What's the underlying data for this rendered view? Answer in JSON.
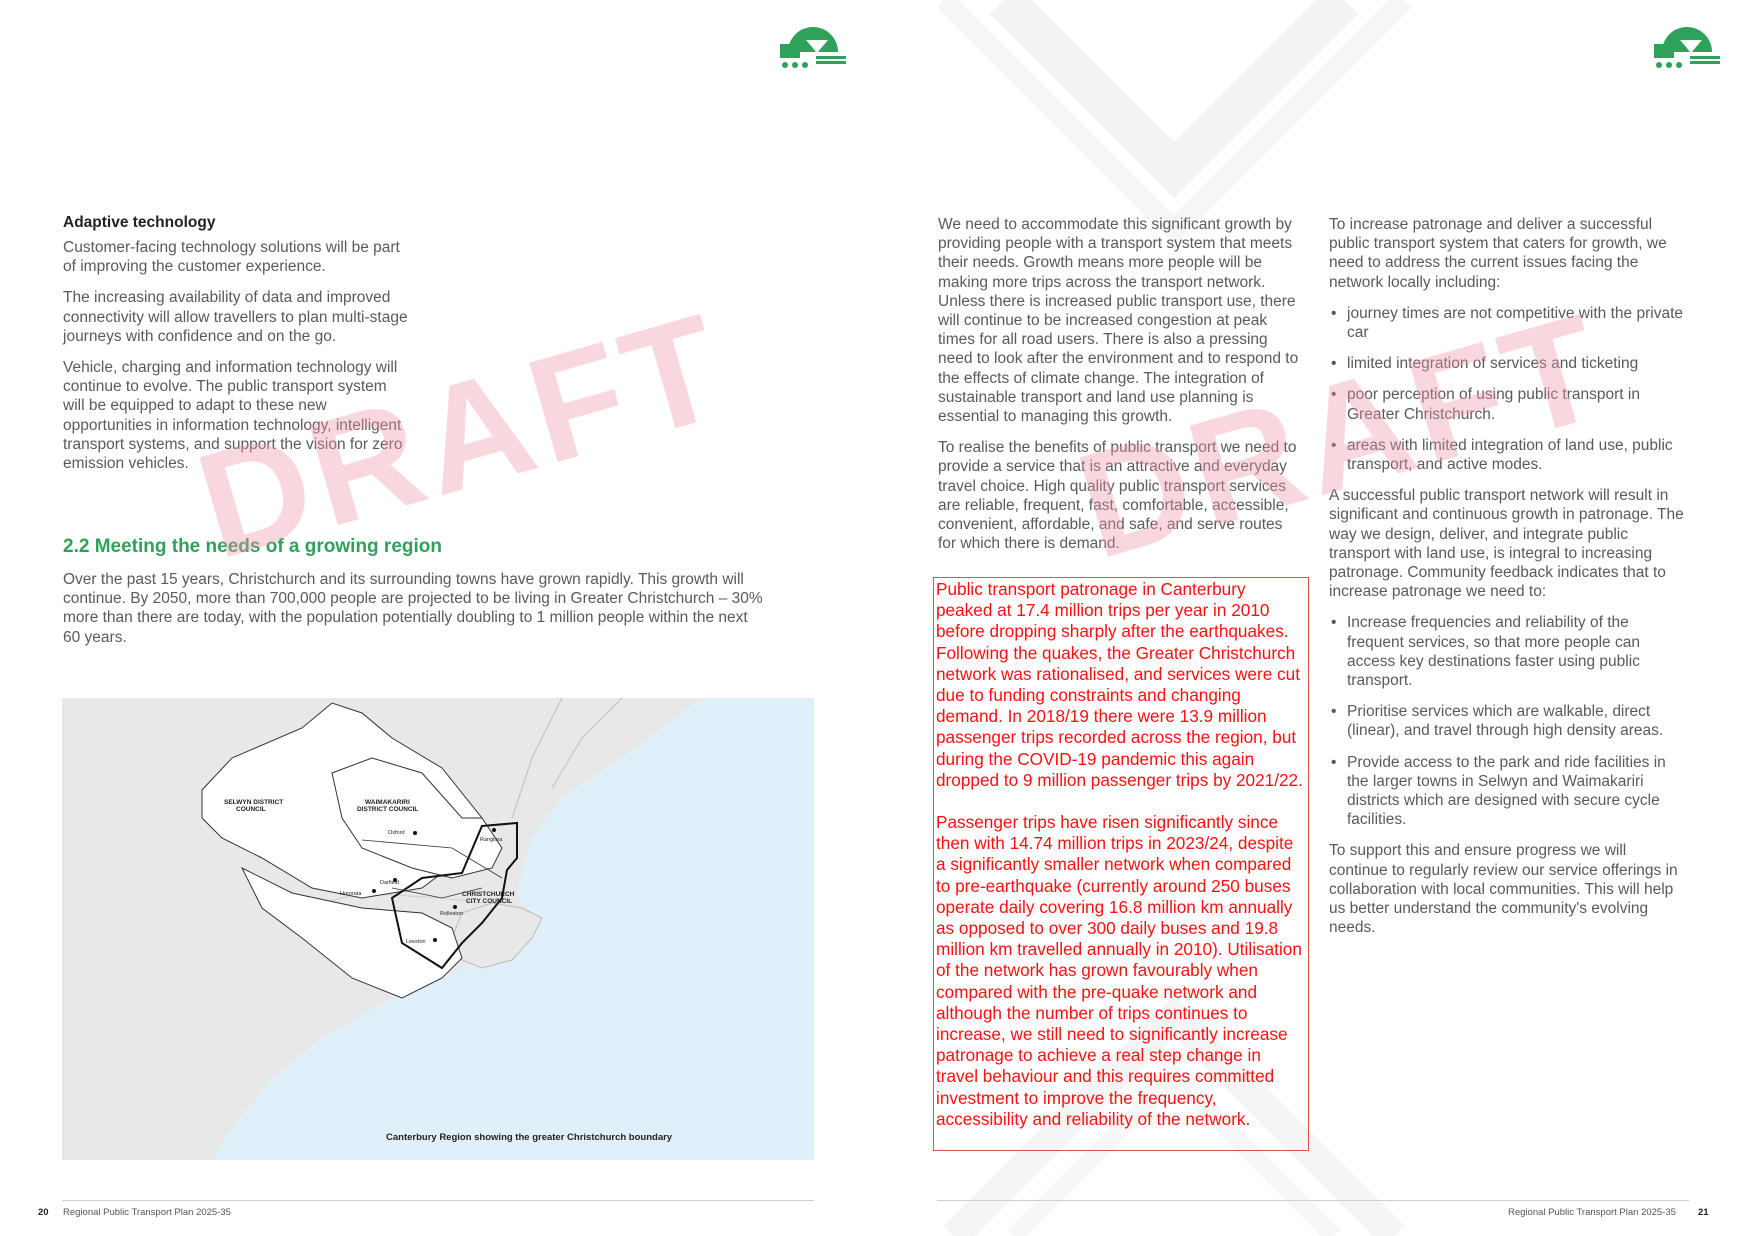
{
  "left_page": {
    "subheading": "Adaptive technology",
    "paragraphs": [
      "Customer-facing technology solutions will be part of improving the customer experience.",
      "The increasing availability of data and improved connectivity will allow travellers to plan multi-stage journeys with confidence and on the go.",
      "Vehicle, charging and information technology will continue to evolve. The public transport system will be equipped to adapt to these new opportunities in information technology, intelligent transport systems, and support the vision for zero emission vehicles."
    ],
    "section_title": "2.2 Meeting the needs of a growing region",
    "section_text": "Over the past 15 years, Christchurch and its surrounding towns have grown rapidly. This growth will continue. By 2050, more than 700,000 people are projected to be living in Greater Christchurch – 30% more than there are today, with the population potentially doubling to 1 million people within the next 60 years.",
    "map": {
      "caption": "Canterbury Region showing the greater Christchurch boundary",
      "labels": {
        "selwyn_1": "SELWYN DISTRICT",
        "selwyn_2": "COUNCIL",
        "waimakariri_1": "WAIMAKARIRI",
        "waimakariri_2": "DISTRICT COUNCIL",
        "chch_1": "CHRISTCHURCH",
        "chch_2": "CITY COUNCIL",
        "oxford": "Oxford",
        "rangiora": "Rangiora",
        "darfield": "Darfield",
        "hororata": "Hororata",
        "rolleston": "Rolleston",
        "leeston": "Leeston"
      }
    },
    "footer": {
      "page_number": "20",
      "doc_title": "Regional Public Transport Plan 2025-35"
    }
  },
  "right_page": {
    "col1_paragraphs": [
      "We need to accommodate this significant growth by providing people with a transport system that meets their needs. Growth means more people will be making more trips across the transport network. Unless there is increased public transport use, there will continue to be increased congestion at peak times for all road users. There is also a pressing need to look after the environment and to respond to the effects of climate change. The integration of sustainable transport and land use planning is essential to managing this growth.",
      "To realise the benefits of public transport we need to provide a service that is an attractive and everyday travel choice. High quality public transport services are reliable, frequent, fast, comfortable, accessible, convenient, affordable, and safe, and serve routes for which there is demand."
    ],
    "redbox_paragraphs": [
      "Public transport patronage in Canterbury peaked at 17.4 million trips per year in 2010 before dropping sharply after the earthquakes. Following the quakes, the Greater Christchurch network was rationalised, and services were cut due to funding constraints and changing demand. In 2018/19 there were 13.9 million passenger trips recorded across the region, but during the COVID-19 pandemic this again dropped to 9 million passenger trips by 2021/22.",
      "Passenger trips have risen significantly since then with 14.74 million trips in 2023/24, despite a significantly smaller network when compared to pre-earthquake (currently around 250 buses operate daily covering 16.8 million km annually as opposed to over 300 daily buses and 19.8 million km travelled annually in 2010). Utilisation of the network has grown favourably when compared with the pre-quake network and although the number of trips continues to increase, we still need to significantly increase patronage to achieve a real step change in travel behaviour and this requires committed investment to improve the frequency, accessibility and reliability of the network."
    ],
    "col2_intro": "To increase patronage and deliver a successful public transport system that caters for growth, we need to address the current issues facing the network locally including:",
    "issues": [
      "journey times are not competitive with the private car",
      "limited integration of services and ticketing",
      "poor perception of using public transport in Greater Christchurch.",
      "areas with limited integration of land use, public transport, and active modes."
    ],
    "col2_middle": "A successful public transport network will result in significant and continuous growth in patronage. The way we design, deliver, and integrate public transport with land use, is integral to increasing patronage. Community feedback indicates that to increase patronage we need to:",
    "needs": [
      "Increase frequencies and reliability of the frequent services, so that more people can access key destinations faster using public transport.",
      "Prioritise services which are walkable, direct (linear), and travel through high density areas.",
      "Provide access to the park and ride facilities in the larger towns in Selwyn and Waimakariri districts which are designed with secure cycle facilities."
    ],
    "col2_closing": "To support this and ensure progress we will continue to regularly review our service offerings in collaboration with local communities. This will help us better understand the community's evolving needs.",
    "footer": {
      "page_number": "21",
      "doc_title": "Regional Public Transport Plan 2025-35"
    }
  },
  "watermark": "DRAFT",
  "colors": {
    "accent_green": "#2ea25a",
    "red_text": "#ff1010",
    "watermark_pink": "#f096aa",
    "sea_blue": "#dff0fb",
    "land_grey": "#e6e6e6"
  },
  "icons": [
    "transport-logo-icon"
  ]
}
